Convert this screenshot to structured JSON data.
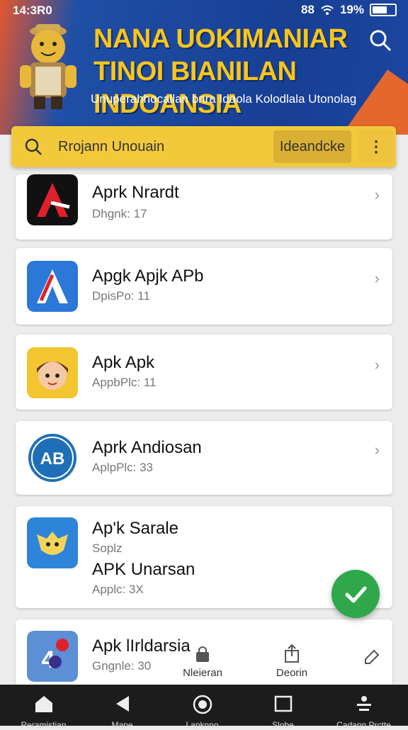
{
  "status": {
    "time": "14:3R0",
    "signal": "88",
    "battery": "19%"
  },
  "header": {
    "title_line1": "NANA UOKIMANIAR",
    "title_line2": "TINOI BIANILAN INDOANSIA",
    "subtitle": "Unuperahhocallan bnra Idaola Kolodlala Utonolag"
  },
  "search": {
    "query": "Rrojann Unouain",
    "filter_label": "Ideandcke",
    "more_label": "⋮"
  },
  "apps": [
    {
      "name": "Aprk Nrardt",
      "meta": "Dhgnk: 17"
    },
    {
      "name": "Apgk Apjk APb",
      "meta": "DpisPo: 11"
    },
    {
      "name": "Apk Apk",
      "meta": "AppbPlc: 11"
    },
    {
      "name": "Aprk Andiosan",
      "meta": "AplpPlc: 33"
    },
    {
      "name": "Ap'k Sarale",
      "meta": "Soplz",
      "name2": "APK Unarsan",
      "meta2": "Applc: 3X"
    },
    {
      "name": "Apk lIrldarsia",
      "meta": "Gngnle: 30"
    }
  ],
  "overlay": {
    "label1": "Nleieran",
    "label2": "Deorin"
  },
  "bottom_nav": [
    {
      "label": "Reramistian",
      "icon": "home-icon"
    },
    {
      "label": "Mape",
      "icon": "back-icon"
    },
    {
      "label": "Lapknno",
      "icon": "record-icon"
    },
    {
      "label": "Slobe",
      "icon": "window-icon"
    },
    {
      "label": "Cadann Prctte",
      "icon": "account-icon"
    }
  ],
  "colors": {
    "accent": "#f3c93c",
    "header": "#173f94",
    "fab": "#2ea84a"
  }
}
